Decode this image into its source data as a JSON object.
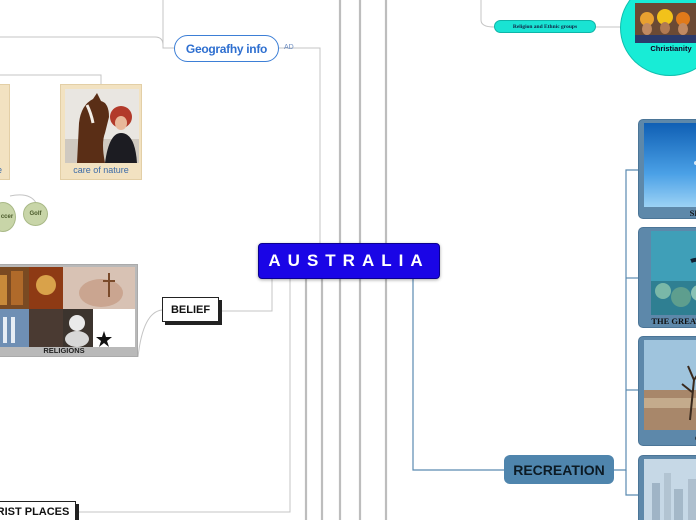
{
  "center": {
    "title": "AUSTRALIA"
  },
  "geography": {
    "label": "Geografhy info",
    "tag": "AD"
  },
  "nature": {
    "left_caption": "re",
    "right_caption": "care of nature"
  },
  "sports": {
    "soccer": "ccer",
    "golf": "Golf"
  },
  "belief": {
    "label": "BELIEF"
  },
  "religions": {
    "caption": "RELIGIONS"
  },
  "recreation": {
    "label": "RECREATION"
  },
  "tourist": {
    "label": "RIST PLACES"
  },
  "ethnic": {
    "label": "Religion and Ethnic groups"
  },
  "christianity": {
    "label": "Christianity"
  },
  "recreation_cards": [
    {
      "caption": "SK"
    },
    {
      "caption": "THE GREAT"
    },
    {
      "caption": "C"
    },
    {
      "caption": ""
    }
  ],
  "colors": {
    "center_bg": "#1a05e6",
    "recreation_bg": "#4f85ad",
    "ethnic_bg": "#19e3d3",
    "geo_border": "#3d7fd6"
  }
}
